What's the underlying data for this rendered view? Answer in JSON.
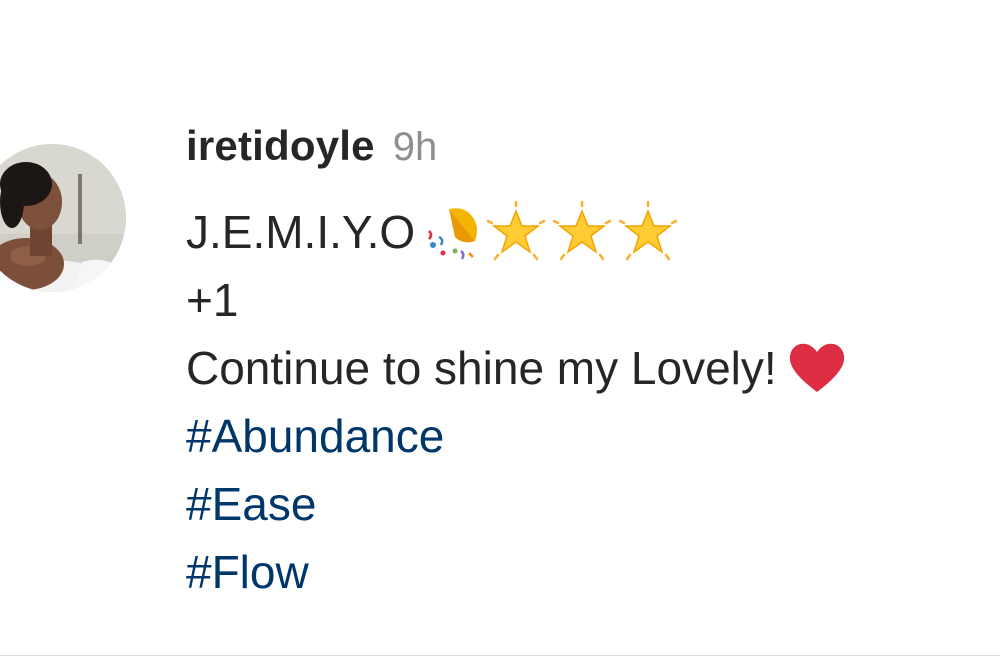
{
  "comment": {
    "username": "iretidoyle",
    "time": "9h",
    "line1_text": "J.E.M.I.Y.O",
    "line1_emojis": [
      "confetti-icon",
      "glowing-star-icon",
      "glowing-star-icon",
      "glowing-star-icon"
    ],
    "line2_text": "+1",
    "line3_text": "Continue to shine my Lovely!",
    "line3_emoji": "red-heart-icon",
    "hashtags": [
      "#Abundance",
      "#Ease",
      "#Flow"
    ]
  },
  "colors": {
    "username": "#262626",
    "time": "#8e8e8e",
    "body": "#262626",
    "hashtag": "#00376b",
    "heart": "#dd2e44",
    "star": "#ffcc33"
  }
}
